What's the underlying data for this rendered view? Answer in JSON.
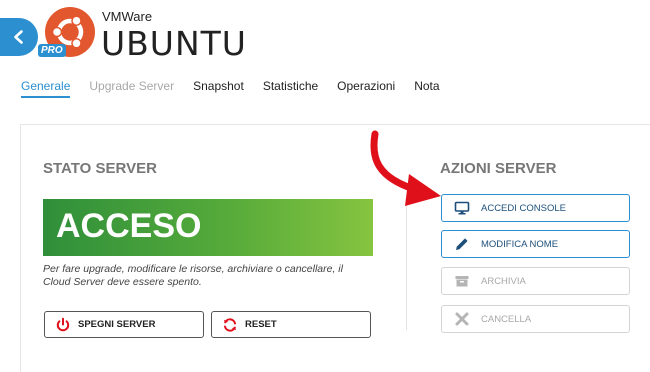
{
  "header": {
    "vendor": "VMWare",
    "title": "UBUNTU",
    "badge": "PRO"
  },
  "tabs": [
    {
      "label": "Generale",
      "state": "active"
    },
    {
      "label": "Upgrade Server",
      "state": "disabled"
    },
    {
      "label": "Snapshot",
      "state": "normal"
    },
    {
      "label": "Statistiche",
      "state": "normal"
    },
    {
      "label": "Operazioni",
      "state": "normal"
    },
    {
      "label": "Nota",
      "state": "normal"
    }
  ],
  "status": {
    "section_title": "STATO SERVER",
    "value": "ACCESO",
    "note": "Per fare upgrade, modificare le risorse, archiviare o cancellare, il Cloud Server deve essere spento.",
    "buttons": {
      "power_off": "SPEGNI SERVER",
      "reset": "RESET"
    }
  },
  "actions": {
    "section_title": "AZIONI SERVER",
    "items": [
      {
        "label": "ACCEDI CONSOLE",
        "icon": "monitor-icon",
        "enabled": true
      },
      {
        "label": "MODIFICA NOME",
        "icon": "pencil-icon",
        "enabled": true
      },
      {
        "label": "ARCHIVIA",
        "icon": "archive-icon",
        "enabled": false
      },
      {
        "label": "CANCELLA",
        "icon": "close-icon",
        "enabled": false
      }
    ]
  },
  "colors": {
    "accent": "#2c8fd0",
    "ubuntu_orange": "#e2572d",
    "status_green": "#55aa3a",
    "arrow_red": "#e0101a"
  }
}
